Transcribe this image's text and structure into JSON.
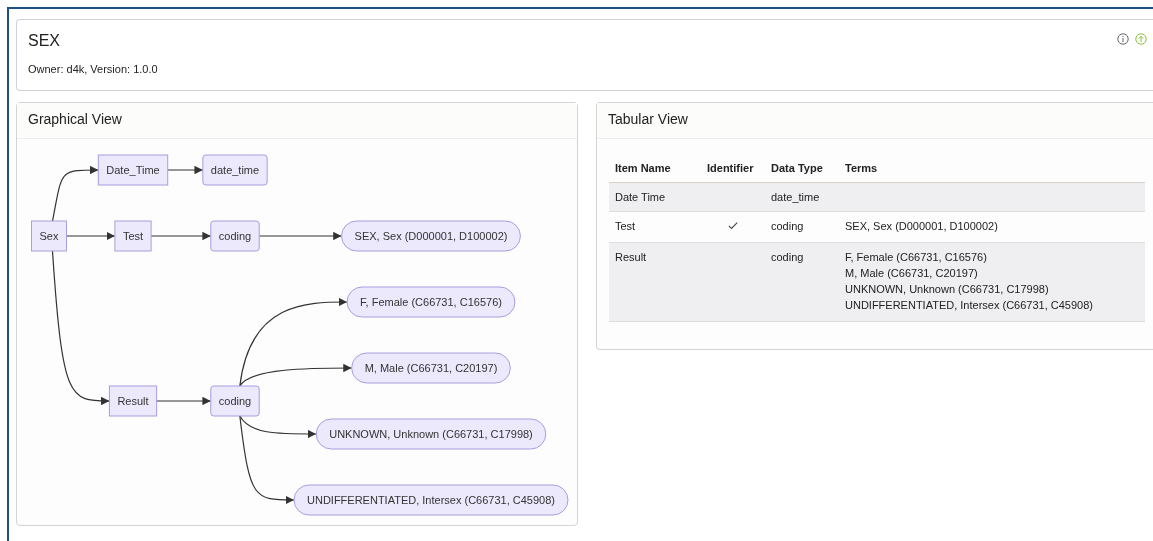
{
  "header": {
    "title": "SEX",
    "subtitle": "Owner: d4k, Version: 1.0.0"
  },
  "graphical_view": {
    "title": "Graphical View",
    "diagram": {
      "label": "Sex",
      "kind": "box",
      "children": [
        {
          "label": "Date_Time",
          "kind": "box",
          "children": [
            {
              "label": "date_time",
              "kind": "rounded"
            }
          ]
        },
        {
          "label": "Test",
          "kind": "box",
          "children": [
            {
              "label": "coding",
              "kind": "rounded",
              "children": [
                {
                  "label": "SEX, Sex (D000001, D100002)",
                  "kind": "pill"
                }
              ]
            }
          ]
        },
        {
          "label": "Result",
          "kind": "box",
          "children": [
            {
              "label": "coding",
              "kind": "rounded",
              "children": [
                {
                  "label": "F, Female (C66731, C16576)",
                  "kind": "pill"
                },
                {
                  "label": "M, Male (C66731, C20197)",
                  "kind": "pill"
                },
                {
                  "label": "UNKNOWN, Unknown (C66731, C17998)",
                  "kind": "pill"
                },
                {
                  "label": "UNDIFFERENTIATED, Intersex (C66731, C45908)",
                  "kind": "pill"
                }
              ]
            }
          ]
        }
      ]
    }
  },
  "tabular_view": {
    "title": "Tabular View",
    "columns": [
      "Item Name",
      "Identifier",
      "Data Type",
      "Terms"
    ],
    "rows": [
      {
        "item_name": "Date Time",
        "identifier": false,
        "data_type": "date_time",
        "terms": []
      },
      {
        "item_name": "Test",
        "identifier": true,
        "data_type": "coding",
        "terms": [
          "SEX, Sex (D000001, D100002)"
        ]
      },
      {
        "item_name": "Result",
        "identifier": false,
        "data_type": "coding",
        "terms": [
          "F, Female (C66731, C16576)",
          "M, Male (C66731, C20197)",
          "UNKNOWN, Unknown (C66731, C17998)",
          "UNDIFFERENTIATED, Intersex (C66731, C45908)"
        ]
      }
    ]
  }
}
